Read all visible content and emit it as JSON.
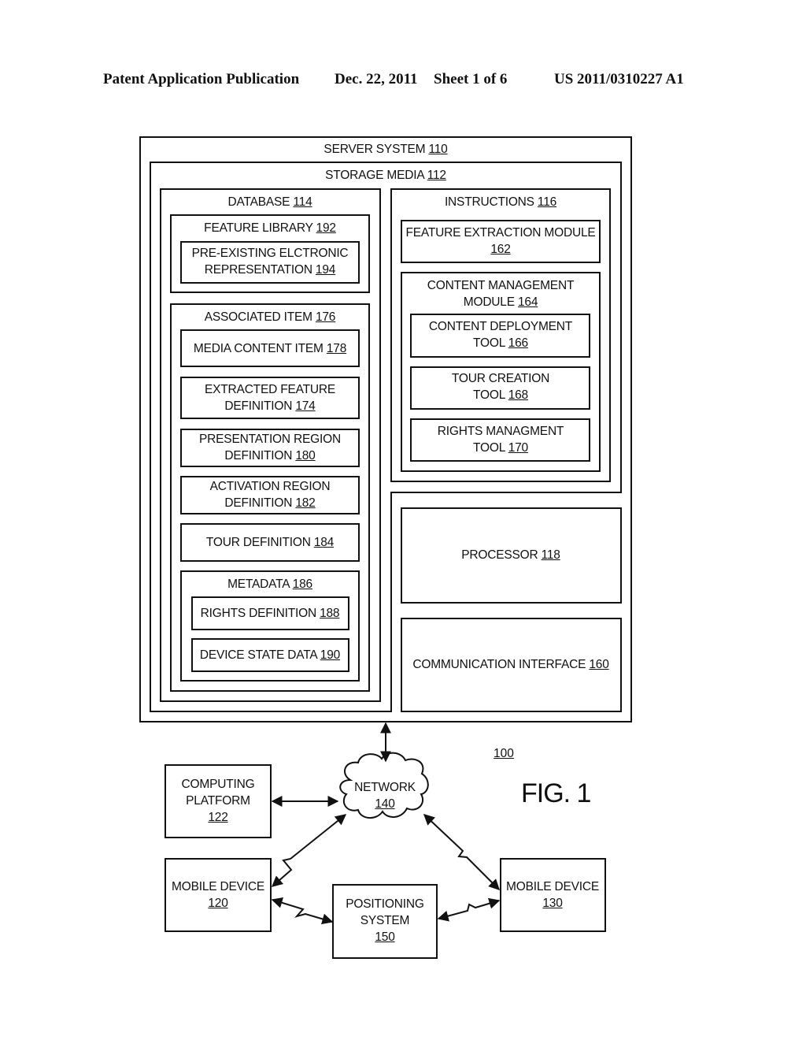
{
  "header": {
    "publication": "Patent Application Publication",
    "date": "Dec. 22, 2011",
    "sheet": "Sheet 1 of 6",
    "number": "US 2011/0310227 A1"
  },
  "figure": {
    "label": "FIG. 1",
    "ref": "100"
  },
  "blocks": {
    "server_system": {
      "name": "SERVER SYSTEM",
      "ref": "110"
    },
    "storage_media": {
      "name": "STORAGE MEDIA",
      "ref": "112"
    },
    "database": {
      "name": "DATABASE",
      "ref": "114"
    },
    "feature_library": {
      "name": "FEATURE LIBRARY",
      "ref": "192"
    },
    "pre_existing": {
      "line1": "PRE-EXISTING ELCTRONIC",
      "line2": "REPRESENTATION",
      "ref": "194"
    },
    "associated_item": {
      "name": "ASSOCIATED ITEM",
      "ref": "176"
    },
    "media_content_item": {
      "name": "MEDIA CONTENT ITEM",
      "ref": "178"
    },
    "extracted_feature": {
      "line1": "EXTRACTED FEATURE",
      "line2": "DEFINITION",
      "ref": "174"
    },
    "presentation_region": {
      "line1": "PRESENTATION REGION",
      "line2": "DEFINITION",
      "ref": "180"
    },
    "activation_region": {
      "line1": "ACTIVATION REGION",
      "line2": "DEFINITION",
      "ref": "182"
    },
    "tour_definition": {
      "name": "TOUR DEFINITION",
      "ref": "184"
    },
    "metadata": {
      "name": "METADATA",
      "ref": "186"
    },
    "rights_definition": {
      "name": "RIGHTS DEFINITION",
      "ref": "188"
    },
    "device_state_data": {
      "name": "DEVICE STATE DATA",
      "ref": "190"
    },
    "instructions": {
      "name": "INSTRUCTIONS",
      "ref": "116"
    },
    "feature_extraction": {
      "line1": "FEATURE EXTRACTION MODULE",
      "ref": "162"
    },
    "content_management": {
      "line1": "CONTENT MANAGEMENT",
      "line2": "MODULE",
      "ref": "164"
    },
    "content_deployment": {
      "line1": "CONTENT DEPLOYMENT",
      "line2": "TOOL",
      "ref": "166"
    },
    "tour_creation": {
      "line1": "TOUR CREATION",
      "line2": "TOOL",
      "ref": "168"
    },
    "rights_management": {
      "line1": "RIGHTS MANAGMENT",
      "line2": "TOOL",
      "ref": "170"
    },
    "processor": {
      "name": "PROCESSOR",
      "ref": "118"
    },
    "communication_interface": {
      "name": "COMMUNICATION INTERFACE",
      "ref": "160"
    },
    "network": {
      "name": "NETWORK",
      "ref": "140"
    },
    "computing_platform": {
      "line1": "COMPUTING",
      "line2": "PLATFORM",
      "ref": "122"
    },
    "mobile_device_120": {
      "name": "MOBILE DEVICE",
      "ref": "120"
    },
    "mobile_device_130": {
      "name": "MOBILE DEVICE",
      "ref": "130"
    },
    "positioning_system": {
      "line1": "POSITIONING",
      "line2": "SYSTEM",
      "ref": "150"
    }
  }
}
